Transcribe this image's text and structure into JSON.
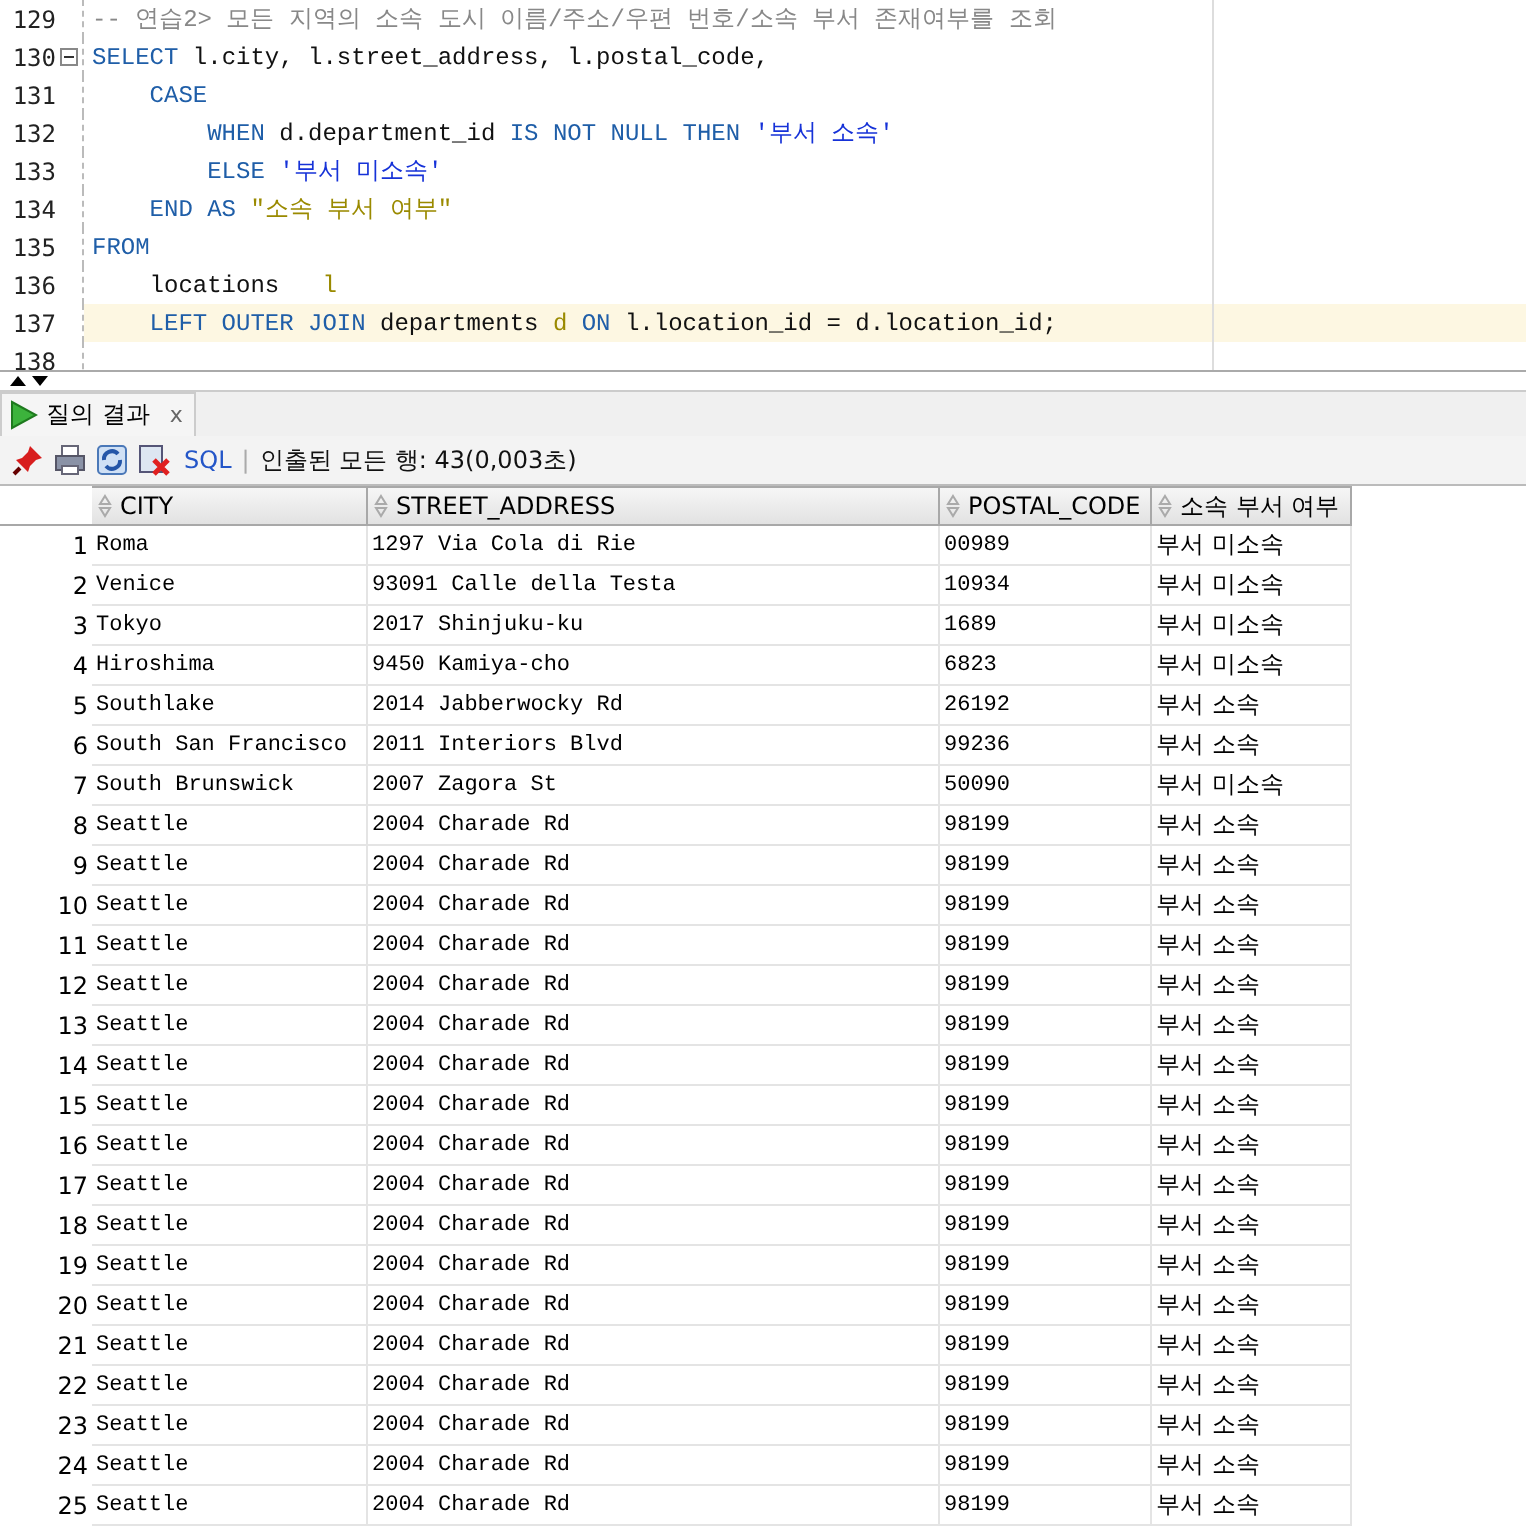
{
  "editor": {
    "lines": [
      {
        "number": "129",
        "highlighted": false,
        "tokens": [
          {
            "kind": "comment",
            "text": "-- 연습2> 모든 지역의 소속 도시 이름/주소/우편 번호/소속 부서 존재여부를 조회"
          }
        ]
      },
      {
        "number": "130",
        "highlighted": false,
        "fold": true,
        "tokens": [
          {
            "kind": "keyword",
            "text": "SELECT"
          },
          {
            "kind": "plain",
            "text": " l.city, l.street_address, l.postal_code,"
          }
        ]
      },
      {
        "number": "131",
        "highlighted": false,
        "tokens": [
          {
            "kind": "keyword",
            "text": "    CASE"
          }
        ]
      },
      {
        "number": "132",
        "highlighted": false,
        "tokens": [
          {
            "kind": "keyword",
            "text": "        WHEN"
          },
          {
            "kind": "plain",
            "text": " d.department_id "
          },
          {
            "kind": "keyword",
            "text": "IS NOT NULL THEN"
          },
          {
            "kind": "string",
            "text": " '부서 소속'"
          }
        ]
      },
      {
        "number": "133",
        "highlighted": false,
        "tokens": [
          {
            "kind": "keyword",
            "text": "        ELSE"
          },
          {
            "kind": "string",
            "text": " '부서 미소속'"
          }
        ]
      },
      {
        "number": "134",
        "highlighted": false,
        "tokens": [
          {
            "kind": "keyword",
            "text": "    END AS"
          },
          {
            "kind": "alias",
            "text": " \"소속 부서 여부\""
          }
        ]
      },
      {
        "number": "135",
        "highlighted": false,
        "tokens": [
          {
            "kind": "keyword",
            "text": "FROM"
          }
        ]
      },
      {
        "number": "136",
        "highlighted": false,
        "tokens": [
          {
            "kind": "plain",
            "text": "    locations   "
          },
          {
            "kind": "alias",
            "text": "l"
          }
        ]
      },
      {
        "number": "137",
        "highlighted": true,
        "tokens": [
          {
            "kind": "keyword",
            "text": "    LEFT OUTER JOIN"
          },
          {
            "kind": "plain",
            "text": " departments "
          },
          {
            "kind": "alias",
            "text": "d"
          },
          {
            "kind": "keyword",
            "text": " ON"
          },
          {
            "kind": "plain",
            "text": " l.location_id = d.location_id;"
          }
        ]
      },
      {
        "number": "138",
        "highlighted": false
      }
    ]
  },
  "results_tab": {
    "label": "질의 결과",
    "close": "x",
    "selected": true
  },
  "toolbar": {
    "sql": "SQL",
    "separator": "|",
    "status": "인출된 모든 행: 43(0,003초)"
  },
  "table": {
    "columns": [
      "CITY",
      "STREET_ADDRESS",
      "POSTAL_CODE",
      "소속 부서 여부"
    ],
    "rows": [
      {
        "number": "1",
        "cells": [
          "Roma",
          "1297 Via Cola di Rie",
          "00989",
          "부서 미소속"
        ]
      },
      {
        "number": "2",
        "cells": [
          "Venice",
          "93091 Calle della Testa",
          "10934",
          "부서 미소속"
        ]
      },
      {
        "number": "3",
        "cells": [
          "Tokyo",
          "2017 Shinjuku-ku",
          "1689",
          "부서 미소속"
        ]
      },
      {
        "number": "4",
        "cells": [
          "Hiroshima",
          "9450 Kamiya-cho",
          "6823",
          "부서 미소속"
        ]
      },
      {
        "number": "5",
        "cells": [
          "Southlake",
          "2014 Jabberwocky Rd",
          "26192",
          "부서 소속"
        ]
      },
      {
        "number": "6",
        "cells": [
          "South San Francisco",
          "2011 Interiors Blvd",
          "99236",
          "부서 소속"
        ]
      },
      {
        "number": "7",
        "cells": [
          "South Brunswick",
          "2007 Zagora St",
          "50090",
          "부서 미소속"
        ]
      },
      {
        "number": "8",
        "cells": [
          "Seattle",
          "2004 Charade Rd",
          "98199",
          "부서 소속"
        ]
      },
      {
        "number": "9",
        "cells": [
          "Seattle",
          "2004 Charade Rd",
          "98199",
          "부서 소속"
        ]
      },
      {
        "number": "10",
        "cells": [
          "Seattle",
          "2004 Charade Rd",
          "98199",
          "부서 소속"
        ]
      },
      {
        "number": "11",
        "cells": [
          "Seattle",
          "2004 Charade Rd",
          "98199",
          "부서 소속"
        ]
      },
      {
        "number": "12",
        "cells": [
          "Seattle",
          "2004 Charade Rd",
          "98199",
          "부서 소속"
        ]
      },
      {
        "number": "13",
        "cells": [
          "Seattle",
          "2004 Charade Rd",
          "98199",
          "부서 소속"
        ]
      },
      {
        "number": "14",
        "cells": [
          "Seattle",
          "2004 Charade Rd",
          "98199",
          "부서 소속"
        ]
      },
      {
        "number": "15",
        "cells": [
          "Seattle",
          "2004 Charade Rd",
          "98199",
          "부서 소속"
        ]
      },
      {
        "number": "16",
        "cells": [
          "Seattle",
          "2004 Charade Rd",
          "98199",
          "부서 소속"
        ]
      },
      {
        "number": "17",
        "cells": [
          "Seattle",
          "2004 Charade Rd",
          "98199",
          "부서 소속"
        ]
      },
      {
        "number": "18",
        "cells": [
          "Seattle",
          "2004 Charade Rd",
          "98199",
          "부서 소속"
        ]
      },
      {
        "number": "19",
        "cells": [
          "Seattle",
          "2004 Charade Rd",
          "98199",
          "부서 소속"
        ]
      },
      {
        "number": "20",
        "cells": [
          "Seattle",
          "2004 Charade Rd",
          "98199",
          "부서 소속"
        ]
      },
      {
        "number": "21",
        "cells": [
          "Seattle",
          "2004 Charade Rd",
          "98199",
          "부서 소속"
        ]
      },
      {
        "number": "22",
        "cells": [
          "Seattle",
          "2004 Charade Rd",
          "98199",
          "부서 소속"
        ]
      },
      {
        "number": "23",
        "cells": [
          "Seattle",
          "2004 Charade Rd",
          "98199",
          "부서 소속"
        ]
      },
      {
        "number": "24",
        "cells": [
          "Seattle",
          "2004 Charade Rd",
          "98199",
          "부서 소속"
        ]
      },
      {
        "number": "25",
        "cells": [
          "Seattle",
          "2004 Charade Rd",
          "98199",
          "부서 소속"
        ]
      }
    ]
  }
}
